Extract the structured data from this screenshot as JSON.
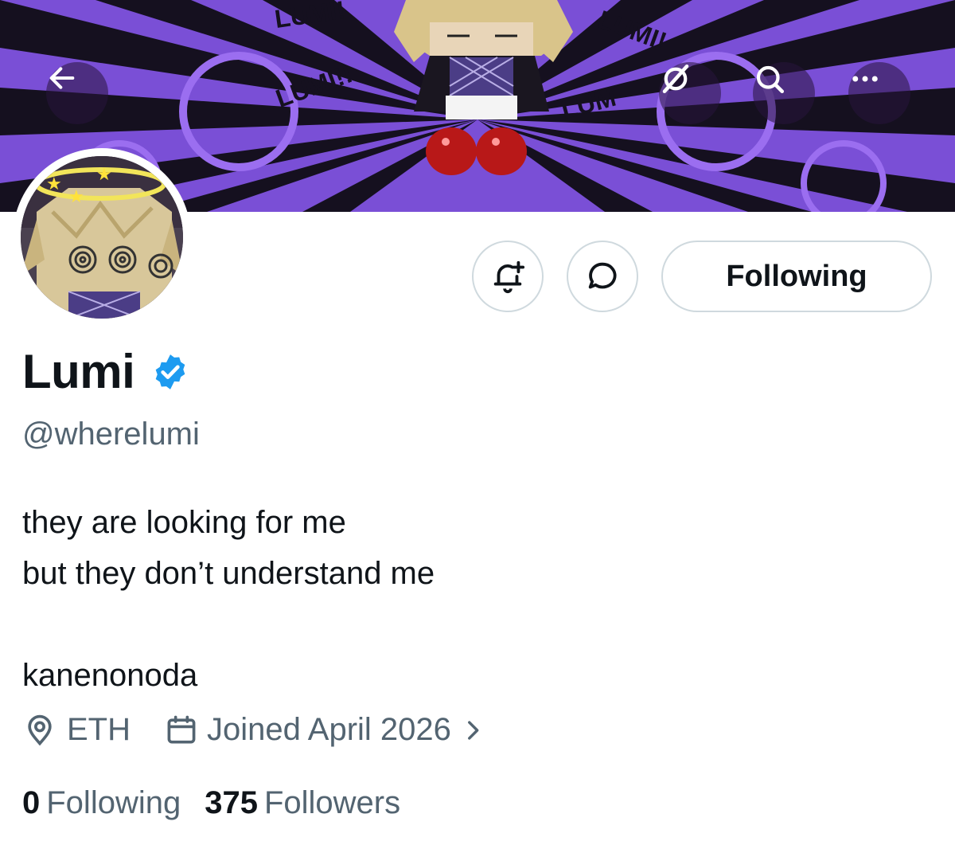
{
  "header": {
    "back_icon": "arrow-left-icon",
    "grok_icon": "grok-icon",
    "search_icon": "search-icon",
    "more_icon": "more-horizontal-icon",
    "banner_texts": [
      "LUMI!",
      "LUMI!!",
      "LUMI!",
      "LUM"
    ]
  },
  "profile": {
    "name": "Lumi",
    "verified": true,
    "handle": "@wherelumi",
    "bio_lines": [
      "they are looking for me",
      "but they don’t understand me",
      "",
      "kanenonoda"
    ],
    "location": "ETH",
    "joined": "Joined April 2026"
  },
  "actions": {
    "notify_icon": "bell-plus-icon",
    "message_icon": "message-bubble-icon",
    "follow_label": "Following"
  },
  "stats": {
    "following_count": "0",
    "following_label": "Following",
    "followers_count": "375",
    "followers_label": "Followers"
  },
  "colors": {
    "banner_purple": "#7a4fd6",
    "verified_blue": "#1d9bf0",
    "secondary_text": "#536471",
    "border": "#cfd9de"
  }
}
